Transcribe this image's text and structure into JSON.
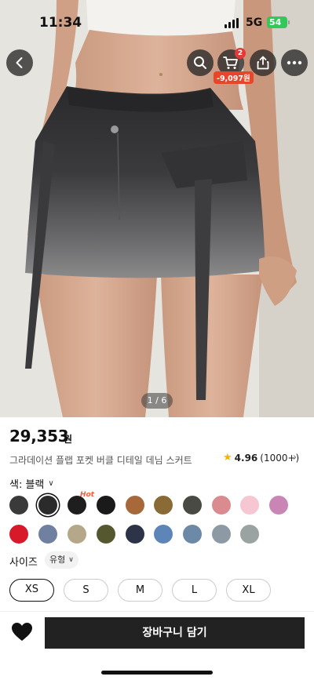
{
  "status_bar": {
    "time": "11:34",
    "network": "5G",
    "battery": "54"
  },
  "header": {
    "back_icon": "chevron-left-icon",
    "search_icon": "search-icon",
    "cart_icon": "cart-icon",
    "cart_count": "2",
    "cart_discount": "-9,097원",
    "share_icon": "share-icon",
    "more_icon": "more-horizontal-icon"
  },
  "gallery": {
    "pager": "1 / 6"
  },
  "product": {
    "price": "29,353",
    "price_unit": "원",
    "title": "그라데이션 플랩 포켓 버클 디테일 데님 스커트",
    "rating": {
      "value": "4.96",
      "count": "(1000+)"
    }
  },
  "color": {
    "label": "색: 블랙",
    "hot_badge": "Hot",
    "swatches": [
      {
        "color": "#3a3a3a",
        "selected": false
      },
      {
        "color": "#2b2b2b",
        "selected": true
      },
      {
        "color": "#1e1e1e",
        "selected": false
      },
      {
        "color": "#1a1a1a",
        "selected": false
      },
      {
        "color": "#a8693a",
        "selected": false
      },
      {
        "color": "#8a6a35",
        "selected": false
      },
      {
        "color": "#4a4a44",
        "selected": false
      },
      {
        "color": "#d98b8f",
        "selected": false
      },
      {
        "color": "#f7c6d3",
        "selected": false
      },
      {
        "color": "#c986b4",
        "selected": false
      },
      {
        "color": "#d7192a",
        "selected": false
      },
      {
        "color": "#7080a0",
        "selected": false
      },
      {
        "color": "#b5a88a",
        "selected": false
      },
      {
        "color": "#55582e",
        "selected": false
      },
      {
        "color": "#2d3448",
        "selected": false
      },
      {
        "color": "#5e85b8",
        "selected": false
      },
      {
        "color": "#6c89a8",
        "selected": false
      },
      {
        "color": "#8d9aa6",
        "selected": false
      },
      {
        "color": "#9aa3a2",
        "selected": false
      }
    ]
  },
  "size": {
    "label": "사이즈",
    "type": "유형",
    "options": [
      "XS",
      "S",
      "M",
      "L",
      "XL"
    ],
    "selected": "XS"
  },
  "actions": {
    "add_to_cart": "장바구니 담기",
    "wishlist_icon": "heart-icon"
  }
}
